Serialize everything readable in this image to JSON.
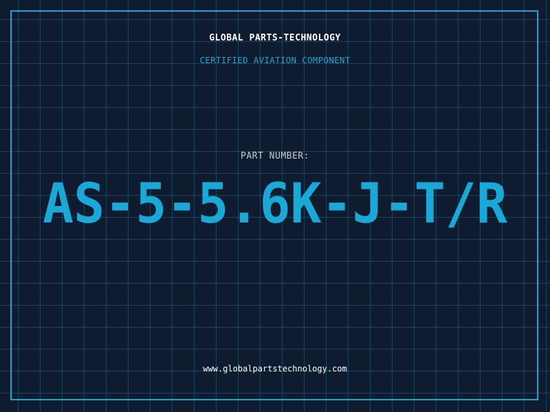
{
  "header": {
    "company": "GLOBAL PARTS-TECHNOLOGY",
    "subtitle": "CERTIFIED AVIATION COMPONENT"
  },
  "part": {
    "label": "PART NUMBER:",
    "number": "AS-5-5.6K-J-T/R"
  },
  "footer": {
    "website": "www.globalpartstechnology.com"
  },
  "colors": {
    "background": "#0f1b2e",
    "grid": "#28789a",
    "accent": "#1da6d4",
    "part_number": "#1aa8d6",
    "text": "#ffffff",
    "muted": "#c7ccd4"
  }
}
